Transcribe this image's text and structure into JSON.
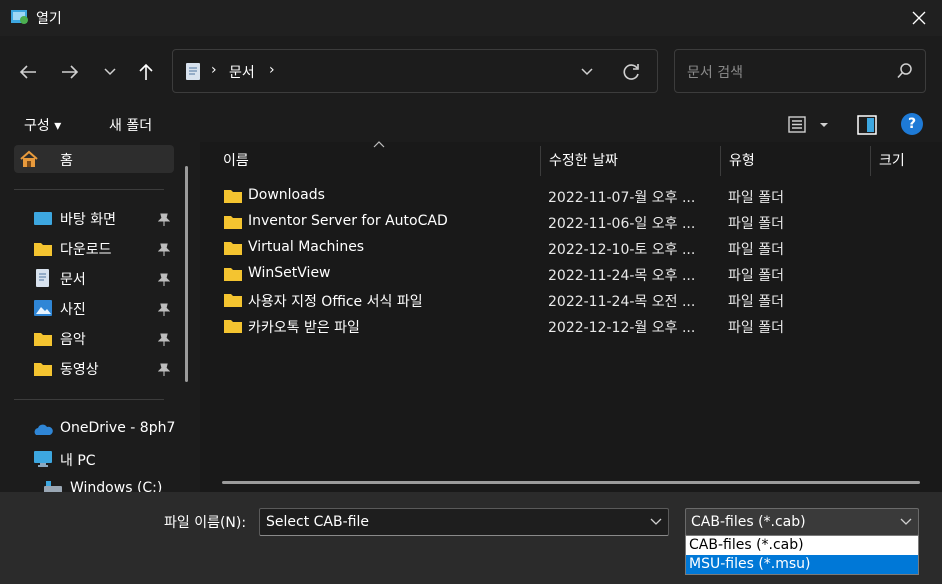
{
  "window": {
    "title": "열기"
  },
  "nav": {
    "back_icon": "arrow-left-icon",
    "forward_icon": "arrow-right-icon",
    "recent_icon": "chevron-down-icon",
    "up_icon": "arrow-up-icon"
  },
  "address": {
    "separator1": "›",
    "crumb": "문서",
    "separator2": "›"
  },
  "search": {
    "placeholder": "문서 검색"
  },
  "commandbar": {
    "organize": "구성 ▾",
    "new_folder": "새 폴더",
    "help": "?"
  },
  "sidebar": {
    "items": [
      {
        "label": "홈",
        "icon": "home-icon",
        "pinned": false
      },
      {
        "label": "바탕 화면",
        "icon": "desktop-icon",
        "pinned": true
      },
      {
        "label": "다운로드",
        "icon": "folder-icon",
        "pinned": true
      },
      {
        "label": "문서",
        "icon": "document-icon",
        "pinned": true
      },
      {
        "label": "사진",
        "icon": "pictures-icon",
        "pinned": true
      },
      {
        "label": "음악",
        "icon": "folder-icon",
        "pinned": true
      },
      {
        "label": "동영상",
        "icon": "folder-icon",
        "pinned": true
      },
      {
        "label": "OneDrive - 8ph7",
        "icon": "onedrive-icon",
        "pinned": false
      },
      {
        "label": "내 PC",
        "icon": "pc-icon",
        "pinned": false
      },
      {
        "label": "Windows (C:)",
        "icon": "drive-icon",
        "pinned": false
      }
    ]
  },
  "columns": {
    "name": "이름",
    "modified": "수정한 날짜",
    "type": "유형",
    "size": "크기"
  },
  "files": [
    {
      "name": "Downloads",
      "modified": "2022-11-07-월 오후 ...",
      "type": "파일 폴더"
    },
    {
      "name": "Inventor Server for AutoCAD",
      "modified": "2022-11-06-일 오후 ...",
      "type": "파일 폴더"
    },
    {
      "name": "Virtual Machines",
      "modified": "2022-12-10-토 오후 ...",
      "type": "파일 폴더"
    },
    {
      "name": "WinSetView",
      "modified": "2022-11-24-목 오후 ...",
      "type": "파일 폴더"
    },
    {
      "name": "사용자 지정 Office 서식 파일",
      "modified": "2022-11-24-목 오전 ...",
      "type": "파일 폴더"
    },
    {
      "name": "카카오톡 받은 파일",
      "modified": "2022-12-12-월 오후 ...",
      "type": "파일 폴더"
    }
  ],
  "footer": {
    "filename_label": "파일 이름(N):",
    "filename_value": "Select CAB-file",
    "filetype_value": "CAB-files (*.cab)",
    "filetype_options": [
      "CAB-files (*.cab)",
      "MSU-files (*.msu)"
    ],
    "filetype_highlighted": "MSU-files (*.msu)"
  },
  "colors": {
    "folder": "#f4c430",
    "accent": "#0078d7",
    "background": "#1c1c1c"
  }
}
